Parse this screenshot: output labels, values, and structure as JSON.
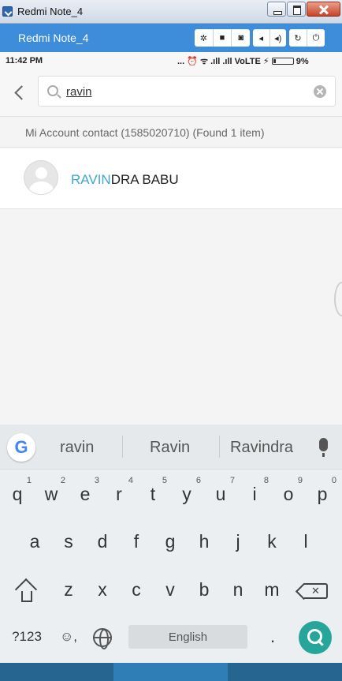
{
  "window": {
    "title": "Redmi Note_4"
  },
  "emulator": {
    "title": "Redmi Note_4"
  },
  "status_bar": {
    "time": "11:42 PM",
    "icons_text": "... ⏰ ᯤ .ıll .ıll VoLTE ⚡",
    "battery": "9%"
  },
  "search": {
    "value": "ravin"
  },
  "results": {
    "header": "Mi Account contact (1585020710) (Found 1 item)",
    "contacts": [
      {
        "name_highlight": "RAVIN",
        "name_rest": "DRA BABU"
      }
    ]
  },
  "keyboard": {
    "suggestions": [
      "ravin",
      "Ravin",
      "Ravindra"
    ],
    "row1": [
      {
        "k": "q",
        "n": "1"
      },
      {
        "k": "w",
        "n": "2"
      },
      {
        "k": "e",
        "n": "3"
      },
      {
        "k": "r",
        "n": "4"
      },
      {
        "k": "t",
        "n": "5"
      },
      {
        "k": "y",
        "n": "6"
      },
      {
        "k": "u",
        "n": "7"
      },
      {
        "k": "i",
        "n": "8"
      },
      {
        "k": "o",
        "n": "9"
      },
      {
        "k": "p",
        "n": "0"
      }
    ],
    "row2": [
      "a",
      "s",
      "d",
      "f",
      "g",
      "h",
      "j",
      "k",
      "l"
    ],
    "row3": [
      "z",
      "x",
      "c",
      "v",
      "b",
      "n",
      "m"
    ],
    "symbols_key": "?123",
    "emoji_key": "☺,",
    "space_label": "English",
    "period_key": "."
  }
}
